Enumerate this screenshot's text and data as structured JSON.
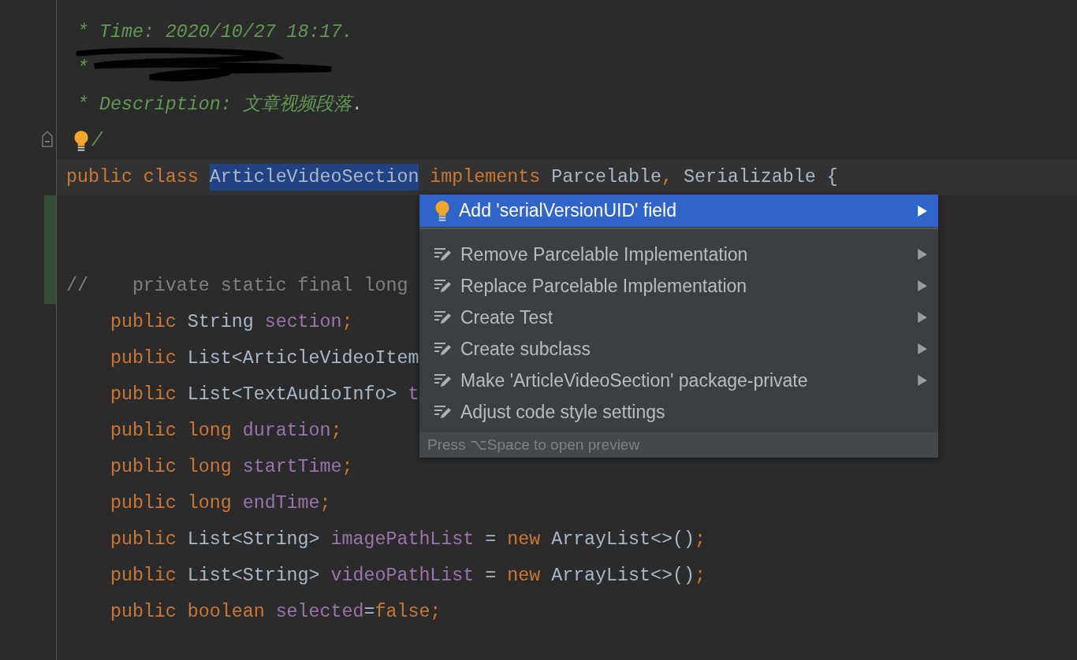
{
  "editor": {
    "lines": [
      {
        "kind": "code",
        "current": false,
        "changed": false,
        "tokens": [
          {
            "text": " * Time: 2020/10/27 18:17.",
            "kind": "doc"
          }
        ]
      },
      {
        "kind": "redacted",
        "current": false,
        "changed": false,
        "tokens": [
          {
            "text": " *",
            "kind": "doc"
          }
        ]
      },
      {
        "kind": "code",
        "current": false,
        "changed": false,
        "tokens": [
          {
            "text": " * Description: 文章视频段落",
            "kind": "doc"
          },
          {
            "text": ".",
            "kind": "plain"
          }
        ]
      },
      {
        "kind": "intention",
        "current": false,
        "changed": false,
        "tokens": [
          {
            "text": "/",
            "kind": "doc"
          }
        ]
      },
      {
        "kind": "code",
        "current": true,
        "changed": false,
        "tokens": [
          {
            "text": "public class ",
            "kind": "keyword"
          },
          {
            "text": "ArticleVideoSection",
            "kind": "highlighted"
          },
          {
            "text": " implements ",
            "kind": "keyword"
          },
          {
            "text": "Parcelable",
            "kind": "plain"
          },
          {
            "text": ", ",
            "kind": "keyword"
          },
          {
            "text": "Serializable {",
            "kind": "plain"
          }
        ]
      },
      {
        "kind": "code",
        "current": false,
        "changed": true
      },
      {
        "kind": "code",
        "current": false,
        "changed": true
      },
      {
        "kind": "code",
        "current": false,
        "changed": true,
        "tokens": [
          {
            "text": "//    private static final long",
            "kind": "comment"
          }
        ]
      },
      {
        "kind": "code",
        "current": false,
        "changed": false,
        "tokens": [
          {
            "text": "    public ",
            "kind": "keyword"
          },
          {
            "text": "String ",
            "kind": "plain"
          },
          {
            "text": "section",
            "kind": "field"
          },
          {
            "text": ";",
            "kind": "keyword"
          }
        ]
      },
      {
        "kind": "code",
        "current": false,
        "changed": false,
        "tokens": [
          {
            "text": "    public ",
            "kind": "keyword"
          },
          {
            "text": "List<ArticleVideoItem",
            "kind": "plain"
          }
        ]
      },
      {
        "kind": "code",
        "current": false,
        "changed": false,
        "tokens": [
          {
            "text": "    public ",
            "kind": "keyword"
          },
          {
            "text": "List<TextAudioInfo> ",
            "kind": "plain"
          },
          {
            "text": "t",
            "kind": "field"
          }
        ]
      },
      {
        "kind": "code",
        "current": false,
        "changed": false,
        "tokens": [
          {
            "text": "    public long ",
            "kind": "keyword"
          },
          {
            "text": "duration",
            "kind": "field"
          },
          {
            "text": ";",
            "kind": "keyword"
          }
        ]
      },
      {
        "kind": "code",
        "current": false,
        "changed": false,
        "tokens": [
          {
            "text": "    public long ",
            "kind": "keyword"
          },
          {
            "text": "startTime",
            "kind": "field"
          },
          {
            "text": ";",
            "kind": "keyword"
          }
        ]
      },
      {
        "kind": "code",
        "current": false,
        "changed": false,
        "tokens": [
          {
            "text": "    public long ",
            "kind": "keyword"
          },
          {
            "text": "endTime",
            "kind": "field"
          },
          {
            "text": ";",
            "kind": "keyword"
          }
        ]
      },
      {
        "kind": "code",
        "current": false,
        "changed": false,
        "tokens": [
          {
            "text": "    public ",
            "kind": "keyword"
          },
          {
            "text": "List<String> ",
            "kind": "plain"
          },
          {
            "text": "imagePathList",
            "kind": "field"
          },
          {
            "text": " = ",
            "kind": "plain"
          },
          {
            "text": "new ",
            "kind": "keyword"
          },
          {
            "text": "ArrayList<>()",
            "kind": "plain"
          },
          {
            "text": ";",
            "kind": "keyword"
          }
        ]
      },
      {
        "kind": "code",
        "current": false,
        "changed": false,
        "tokens": [
          {
            "text": "    public ",
            "kind": "keyword"
          },
          {
            "text": "List<String> ",
            "kind": "plain"
          },
          {
            "text": "videoPathList",
            "kind": "field"
          },
          {
            "text": " = ",
            "kind": "plain"
          },
          {
            "text": "new ",
            "kind": "keyword"
          },
          {
            "text": "ArrayList<>()",
            "kind": "plain"
          },
          {
            "text": ";",
            "kind": "keyword"
          }
        ]
      },
      {
        "kind": "code",
        "current": false,
        "changed": false,
        "tokens": [
          {
            "text": "    public boolean ",
            "kind": "keyword"
          },
          {
            "text": "selected",
            "kind": "field"
          },
          {
            "text": "=",
            "kind": "plain"
          },
          {
            "text": "false;",
            "kind": "keyword"
          }
        ]
      }
    ]
  },
  "popup": {
    "items": [
      {
        "label": "Add 'serialVersionUID' field",
        "kind": "suggestion",
        "selected": true,
        "submenu": true
      },
      {
        "label": "Remove Parcelable Implementation",
        "kind": "action",
        "selected": false,
        "submenu": true
      },
      {
        "label": "Replace Parcelable Implementation",
        "kind": "action",
        "selected": false,
        "submenu": true
      },
      {
        "label": "Create Test",
        "kind": "action",
        "selected": false,
        "submenu": true
      },
      {
        "label": "Create subclass",
        "kind": "action",
        "selected": false,
        "submenu": true
      },
      {
        "label": "Make 'ArticleVideoSection' package-private",
        "kind": "action",
        "selected": false,
        "submenu": true
      },
      {
        "label": "Adjust code style settings",
        "kind": "action",
        "selected": false,
        "submenu": false
      }
    ],
    "footer": "Press ⌥Space to open preview"
  }
}
